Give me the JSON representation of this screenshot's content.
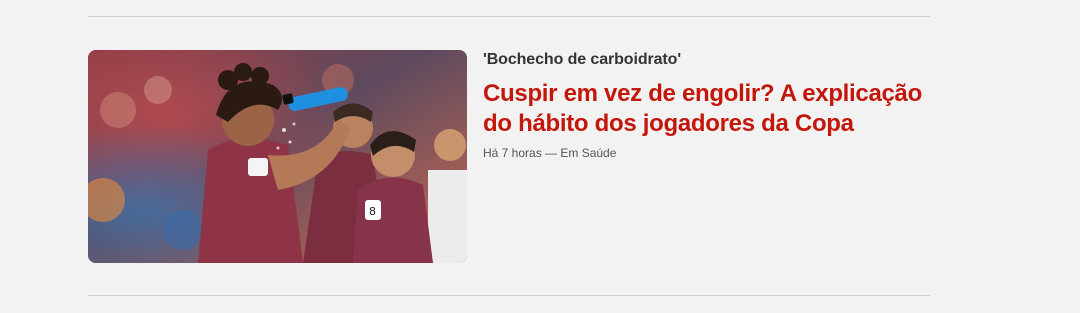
{
  "feed_item": {
    "kicker": "'Bochecho de carboidrato'",
    "headline": "Cuspir em vez de engolir? A explicação do hábito dos jogadores da Copa",
    "time": "Há 7 horas",
    "separator": " — ",
    "section": "Em Saúde",
    "thumbnail_alt": "Jogadores com camisa grená bebendo água de garrafa azul",
    "headline_color": "#c4170c"
  }
}
